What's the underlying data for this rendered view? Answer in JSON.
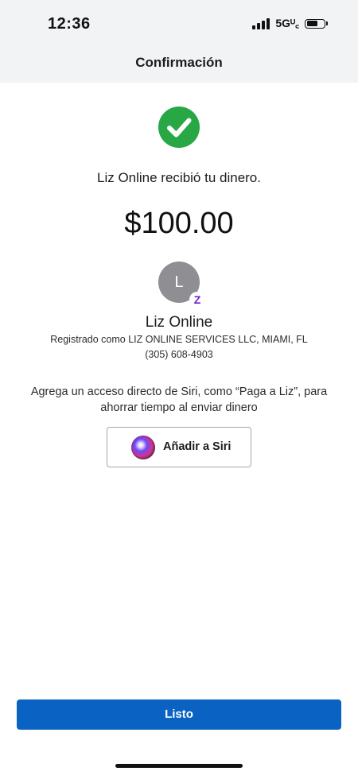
{
  "status_bar": {
    "time": "12:36",
    "network": "5Gᵁ꜀",
    "battery_level": 0.65
  },
  "header": {
    "title": "Confirmación"
  },
  "confirmation": {
    "message": "Liz Online recibió tu dinero.",
    "amount": "$100.00",
    "success_color": "#28a745"
  },
  "recipient": {
    "avatar_initial": "L",
    "badge": "Z",
    "name": "Liz Online",
    "registered_as": "Registrado como LIZ ONLINE SERVICES LLC, MIAMI, FL",
    "phone": "(305) 608-4903"
  },
  "siri": {
    "message": "Agrega un acceso directo de Siri, como “Paga a Liz”, para ahorrar tiempo al enviar dinero",
    "button_label": "Añadir a Siri"
  },
  "footer": {
    "done_label": "Listo",
    "primary_color": "#0a63c2"
  }
}
